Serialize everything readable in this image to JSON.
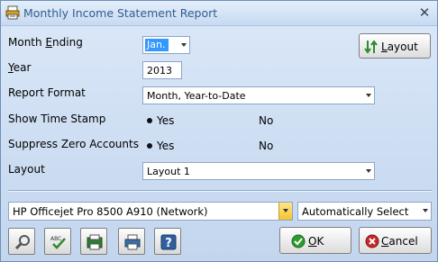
{
  "window": {
    "title": "Monthly Income Statement Report",
    "close_icon": "close-icon",
    "app_icon": "report-printer-icon"
  },
  "form": {
    "month_ending": {
      "label_prefix": "Month ",
      "label_accel": "E",
      "label_suffix": "nding",
      "value": "Jan."
    },
    "year": {
      "label_accel": "Y",
      "label_suffix": "ear",
      "value": "2013"
    },
    "report_format": {
      "label": "Report Format",
      "value": "Month, Year-to-Date"
    },
    "show_time_stamp": {
      "label": "Show Time Stamp",
      "yes_label": "Yes",
      "no_label": "No",
      "selected": "Yes"
    },
    "suppress_zero_accounts": {
      "label": "Suppress Zero Accounts",
      "yes_label": "Yes",
      "no_label": "No",
      "selected": "Yes"
    },
    "layout": {
      "label": "Layout",
      "value": "Layout 1"
    },
    "layout_button": {
      "label_accel": "L",
      "label_suffix": "ayout"
    }
  },
  "printer": {
    "name": "HP Officejet Pro 8500 A910 (Network)",
    "tray": "Automatically Select"
  },
  "toolbar": {
    "icons": [
      "preview-magnifier-icon",
      "spell-check-icon",
      "export-icon",
      "print-icon",
      "help-icon"
    ],
    "help_glyph": "?"
  },
  "actions": {
    "ok_accel": "O",
    "ok_suffix": "K",
    "cancel_accel": "C",
    "cancel_suffix": "ancel"
  },
  "colors": {
    "window_bg": "#c3d6ee",
    "title_text": "#315d91",
    "selection": "#3399ff",
    "ok_check": "#2e9b2e",
    "cancel_x": "#c62828"
  }
}
